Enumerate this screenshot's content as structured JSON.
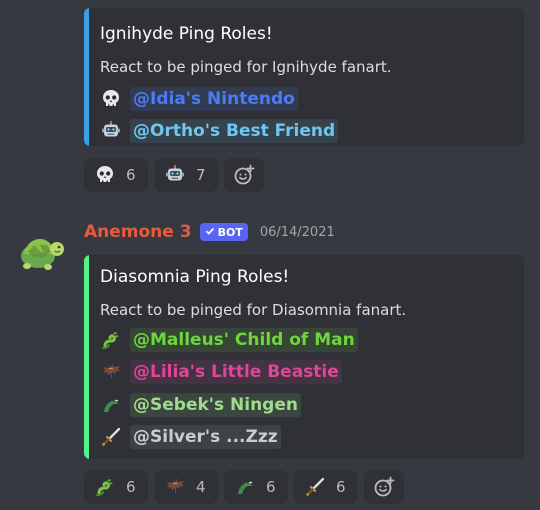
{
  "message1": {
    "embed": {
      "accent_color": "#3ba0e7",
      "title": "Ignihyde Ping Roles!",
      "description": "React to be pinged for Ignihyde fanart.",
      "roles": [
        {
          "emoji": "skull-icon",
          "mention": "@Idia's Nintendo",
          "color": "#4a7cf6"
        },
        {
          "emoji": "robot-icon",
          "mention": "@Ortho's Best Friend",
          "color": "#6ec6f2"
        }
      ]
    },
    "reactions": [
      {
        "emoji": "skull-icon",
        "count": "6"
      },
      {
        "emoji": "robot-icon",
        "count": "7"
      }
    ]
  },
  "message2": {
    "username": "Anemone 3",
    "bot_label": "BOT",
    "timestamp": "06/14/2021",
    "embed": {
      "accent_color": "#57f287",
      "title": "Diasomnia Ping Roles!",
      "description": "React to be pinged for Diasomnia fanart.",
      "roles": [
        {
          "emoji": "dragon-icon",
          "mention": "@Malleus' Child of Man",
          "color": "#6fd63c"
        },
        {
          "emoji": "bat-icon",
          "mention": "@Lilia's Little Beastie",
          "color": "#e0459a"
        },
        {
          "emoji": "crocodile-icon",
          "mention": "@Sebek's Ningen",
          "color": "#9fdc8c"
        },
        {
          "emoji": "sword-icon",
          "mention": "@Silver's ...Zzz",
          "color": "#c9ccd1"
        }
      ]
    },
    "reactions": [
      {
        "emoji": "dragon-icon",
        "count": "6"
      },
      {
        "emoji": "bat-icon",
        "count": "4"
      },
      {
        "emoji": "crocodile-icon",
        "count": "6"
      },
      {
        "emoji": "sword-icon",
        "count": "6"
      }
    ]
  }
}
